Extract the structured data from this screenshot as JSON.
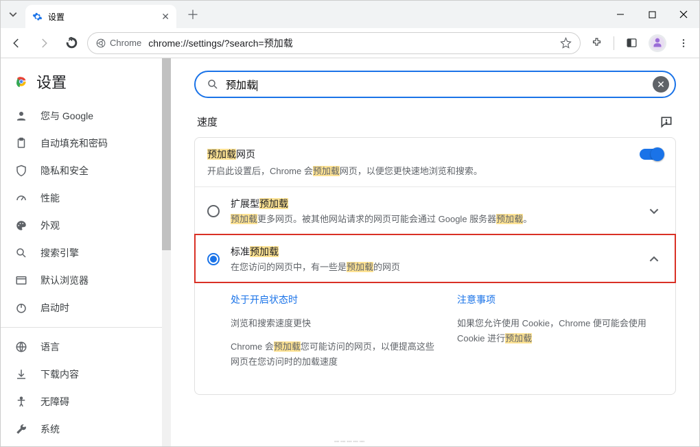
{
  "window": {
    "tab_title": "设置",
    "url": "chrome://settings/?search=预加载",
    "omnibox_chrome_label": "Chrome"
  },
  "brand": {
    "title": "设置"
  },
  "sidebar": {
    "items": [
      {
        "label": "您与 Google"
      },
      {
        "label": "自动填充和密码"
      },
      {
        "label": "隐私和安全"
      },
      {
        "label": "性能"
      },
      {
        "label": "外观"
      },
      {
        "label": "搜索引擎"
      },
      {
        "label": "默认浏览器"
      },
      {
        "label": "启动时"
      }
    ],
    "more": [
      {
        "label": "语言"
      },
      {
        "label": "下载内容"
      },
      {
        "label": "无障碍"
      },
      {
        "label": "系统"
      }
    ]
  },
  "search": {
    "value": "预加载"
  },
  "section": {
    "title": "速度"
  },
  "preload": {
    "title_hl": "预加载",
    "title_suffix": "网页",
    "desc_a": "开启此设置后，Chrome 会",
    "desc_hl": "预加载",
    "desc_b": "网页，以便您更快速地浏览和搜索。",
    "options": [
      {
        "title_prefix": "扩展型",
        "title_hl": "预加载",
        "desc_hl1": "预加载",
        "desc_a": "更多网页。被其他网站请求的网页可能会通过 Google 服务器",
        "desc_hl2": "预加载",
        "desc_b": "。",
        "selected": false
      },
      {
        "title_prefix": "标准",
        "title_hl": "预加载",
        "desc_a": "在您访问的网页中，有一些是",
        "desc_hl": "预加载",
        "desc_b": "的网页",
        "selected": true
      }
    ],
    "detail": {
      "left": {
        "heading": "处于开启状态时",
        "p1": "浏览和搜索速度更快",
        "p2a": "Chrome 会",
        "p2hl": "预加载",
        "p2b": "您可能访问的网页，以便提高这些网页在您访问时的加载速度"
      },
      "right": {
        "heading": "注意事项",
        "p1a": "如果您允许使用 Cookie，Chrome 便可能会使用 Cookie 进行",
        "p1hl": "预加载"
      }
    }
  }
}
